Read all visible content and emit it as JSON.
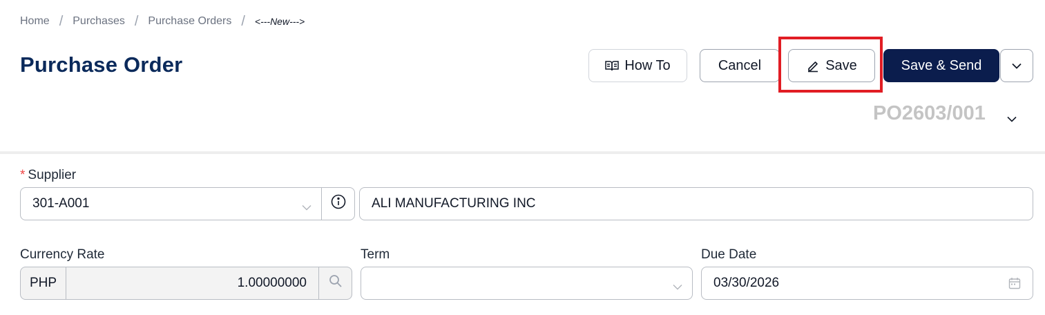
{
  "breadcrumb": {
    "items": [
      "Home",
      "Purchases",
      "Purchase Orders"
    ],
    "separator": "/",
    "current": "<---New--->"
  },
  "page": {
    "title": "Purchase Order"
  },
  "toolbar": {
    "how_to_label": "How To",
    "cancel_label": "Cancel",
    "save_label": "Save",
    "save_send_label": "Save & Send",
    "more_icon": "chevron-down-icon"
  },
  "po": {
    "number": "PO2603/001"
  },
  "supplier": {
    "label": "Supplier",
    "required_mark": "*",
    "code": "301-A001",
    "name": "ALI MANUFACTURING INC"
  },
  "currency": {
    "label": "Currency Rate",
    "code": "PHP",
    "rate": "1.00000000"
  },
  "term": {
    "label": "Term",
    "value": ""
  },
  "due_date": {
    "label": "Due Date",
    "value": "03/30/2026"
  },
  "colors": {
    "title": "#0b2a5b",
    "primary_button": "#0b1d4d",
    "highlight": "#e11d24",
    "required": "#ef4444",
    "po_number": "#c4c4c4"
  }
}
